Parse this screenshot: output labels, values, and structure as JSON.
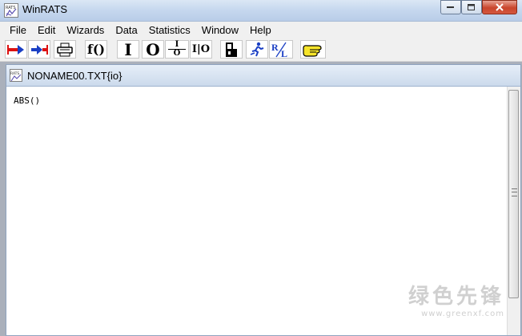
{
  "window": {
    "title": "WinRATS",
    "controls": {
      "minimize": "–",
      "maximize": "□",
      "close": "x"
    }
  },
  "menu": [
    "File",
    "Edit",
    "Wizards",
    "Data",
    "Statistics",
    "Window",
    "Help"
  ],
  "toolbar": {
    "buttons": [
      {
        "name": "run-forward-button",
        "icon": "red-arrow-right-blue",
        "label": ""
      },
      {
        "name": "run-back-button",
        "icon": "blue-arrow-right-red",
        "label": ""
      },
      {
        "name": "print-button",
        "icon": "printer-icon",
        "label": ""
      },
      {
        "name": "function-button",
        "label": "f()"
      },
      {
        "name": "input-button",
        "label": "I"
      },
      {
        "name": "output-button",
        "label": "O"
      },
      {
        "name": "io-fraction-button",
        "label_top": "I",
        "label_bottom": "O"
      },
      {
        "name": "io-button",
        "label": "I|O"
      },
      {
        "name": "lock-button",
        "icon": "lock-icon",
        "label": ""
      },
      {
        "name": "wizard-button",
        "icon": "running-figure-icon",
        "label": ""
      },
      {
        "name": "rl-button",
        "label_r": "R",
        "label_l": "L"
      },
      {
        "name": "help-button",
        "icon": "pointing-hand-icon",
        "label": ""
      }
    ]
  },
  "document": {
    "title": "NONAME00.TXT{io}",
    "content": "ABS()"
  },
  "watermark": {
    "chinese": "绿色先锋",
    "url": "www.greenxf.com"
  },
  "colors": {
    "title_gradient": "#c5d7ee",
    "close_button": "#c9452c",
    "mdi_background": "#aab0bb"
  }
}
